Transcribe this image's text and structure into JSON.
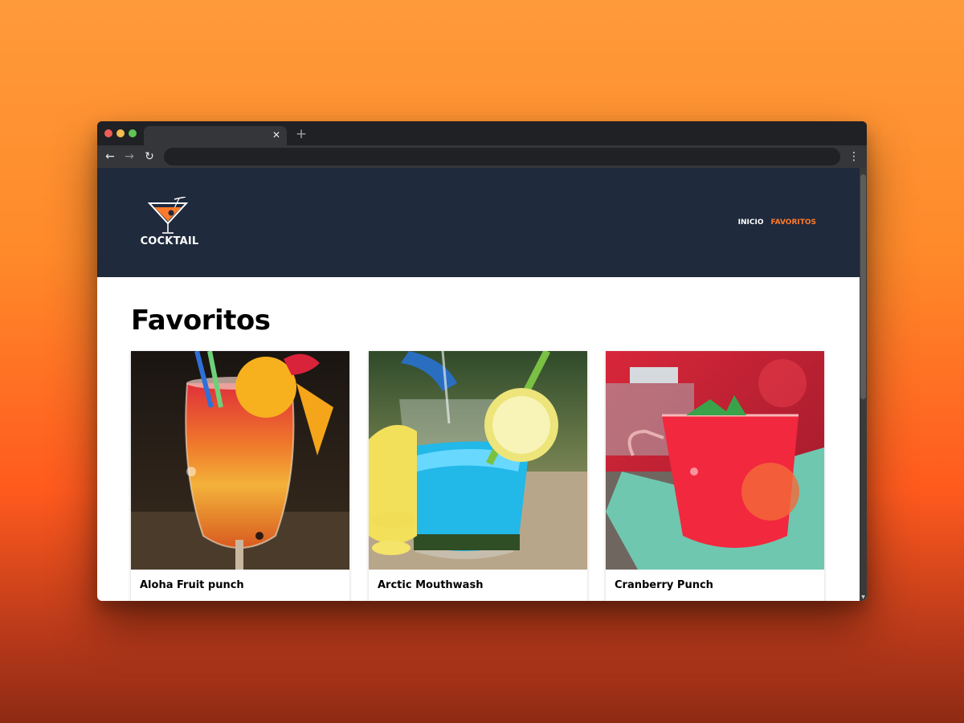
{
  "browser": {
    "tab": {
      "close_glyph": "✕"
    },
    "new_tab_glyph": "+",
    "nav": {
      "back_glyph": "←",
      "forward_glyph": "→",
      "reload_glyph": "↻",
      "menu_glyph": "⋮"
    },
    "address_bar": {
      "value": ""
    }
  },
  "site": {
    "logo_text": "COCKTAIL",
    "nav": {
      "inicio_label": "INICIO",
      "favoritos_label": "FAVORITOS"
    },
    "accent_color": "#ff7a2a",
    "header_color": "#1f2a3d"
  },
  "main": {
    "title": "Favoritos",
    "cards": [
      {
        "name": "Aloha Fruit punch",
        "image_icon": "tropical-cocktail-photo"
      },
      {
        "name": "Arctic Mouthwash",
        "image_icon": "blue-slush-cocktail-photo"
      },
      {
        "name": "Cranberry Punch",
        "image_icon": "red-punch-cocktail-photo"
      }
    ]
  }
}
